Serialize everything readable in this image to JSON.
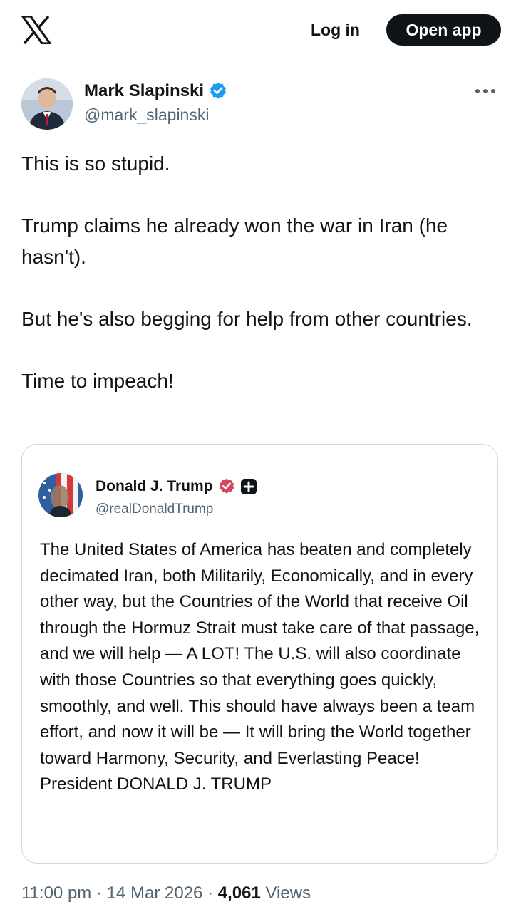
{
  "topbar": {
    "logo_icon": "x-logo-icon",
    "login_label": "Log in",
    "open_app_label": "Open app"
  },
  "post": {
    "author_name": "Mark Slapinski",
    "author_handle": "@mark_slapinski",
    "verified_icon": "verified-badge-icon",
    "verified_color": "#1d9bf0",
    "more_icon": "more-options-icon",
    "paragraphs": [
      "This is so stupid.",
      "Trump claims he already won the war in Iran (he hasn't).",
      "But he's also begging for help from other countries.",
      "Time to impeach!"
    ],
    "timestamp": "11:00 pm",
    "date": "14 Mar 2026",
    "separator": "·",
    "views_count": "4,061",
    "views_label": "Views"
  },
  "quote": {
    "author_name": "Donald J. Trump",
    "author_handle": "@realDonaldTrump",
    "badge_icon": "truth-verified-badge-icon",
    "badge_color": "#d1485f",
    "plus_icon": "plus-badge-icon",
    "text": "The United States of America has beaten and completely decimated Iran, both Militarily, Economically, and in every other way, but the Countries of the World that receive Oil through the Hormuz Strait must take care of that passage, and we will help — A LOT! The U.S. will also coordinate with those Countries so that everything goes quickly, smoothly, and well. This should have always been a team effort, and now it will be — It will bring the World together toward Harmony, Security, and Everlasting Peace! President DONALD J. TRUMP"
  }
}
